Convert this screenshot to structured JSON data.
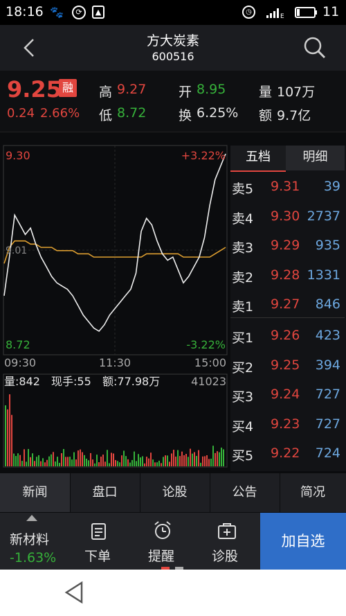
{
  "status": {
    "time": "18:16",
    "battery": "11"
  },
  "header": {
    "name": "方大炭素",
    "code": "600516"
  },
  "quote": {
    "price": "9.25",
    "badge": "融",
    "change": "0.24",
    "change_pct": "2.66%",
    "high_label": "高",
    "high": "9.27",
    "low_label": "低",
    "low": "8.72",
    "open_label": "开",
    "open": "8.95",
    "turnover_label": "换",
    "turnover": "6.25%",
    "volume_label": "量",
    "volume": "107万",
    "amount_label": "额",
    "amount": "9.7亿"
  },
  "chart": {
    "price_high": "9.30",
    "price_low": "8.72",
    "price_mid": "9.01",
    "pct_high": "+3.22%",
    "pct_low": "-3.22%",
    "time_start": "09:30",
    "time_mid": "11:30",
    "time_end": "15:00",
    "vol_label": "量:842",
    "hand_label": "现手:55",
    "amt_label": "额:77.98万",
    "vol_max": "41023",
    "colors": {
      "price_line": "#f0f0f0",
      "avg_line": "#e0a030",
      "up": "#e2463f",
      "down": "#36b23a"
    }
  },
  "chart_data": {
    "type": "line",
    "xlabel": "",
    "ylabel": "",
    "x_ticks": [
      "09:30",
      "11:30",
      "15:00"
    ],
    "ylim": [
      8.72,
      9.3
    ],
    "series": [
      {
        "values": [
          8.86,
          8.98,
          9.11,
          9.08,
          9.05,
          9.07,
          9.02,
          8.98,
          8.95,
          8.92,
          8.9,
          8.89,
          8.88,
          8.86,
          8.83,
          8.8,
          8.78,
          8.76,
          8.75,
          8.77,
          8.8,
          8.82,
          8.84,
          8.86,
          8.88,
          8.93,
          9.06,
          9.1,
          9.08,
          9.03,
          8.99,
          8.97,
          8.98,
          8.94,
          8.9,
          8.92,
          8.95,
          8.98,
          9.04,
          9.14,
          9.22,
          9.26,
          9.3
        ]
      },
      {
        "values": [
          8.96,
          9.01,
          9.03,
          9.03,
          9.03,
          9.02,
          9.02,
          9.01,
          9.01,
          9.01,
          9.0,
          9.0,
          9.0,
          9.0,
          8.99,
          8.99,
          8.99,
          8.98,
          8.98,
          8.98,
          8.98,
          8.98,
          8.98,
          8.98,
          8.98,
          8.98,
          8.98,
          8.99,
          8.99,
          8.99,
          8.99,
          8.99,
          8.99,
          8.99,
          8.98,
          8.98,
          8.98,
          8.98,
          8.98,
          8.98,
          8.99,
          9.0,
          9.01
        ]
      }
    ]
  },
  "book": {
    "tab_five": "五档",
    "tab_detail": "明细",
    "rows": [
      {
        "label": "卖5",
        "price": "9.31",
        "vol": "39"
      },
      {
        "label": "卖4",
        "price": "9.30",
        "vol": "2737"
      },
      {
        "label": "卖3",
        "price": "9.29",
        "vol": "935"
      },
      {
        "label": "卖2",
        "price": "9.28",
        "vol": "1331"
      },
      {
        "label": "卖1",
        "price": "9.27",
        "vol": "846"
      },
      {
        "label": "买1",
        "price": "9.26",
        "vol": "423"
      },
      {
        "label": "买2",
        "price": "9.25",
        "vol": "394"
      },
      {
        "label": "买3",
        "price": "9.24",
        "vol": "727"
      },
      {
        "label": "买4",
        "price": "9.23",
        "vol": "727"
      },
      {
        "label": "买5",
        "price": "9.22",
        "vol": "724"
      }
    ]
  },
  "tabs": [
    "新闻",
    "盘口",
    "论股",
    "公告",
    "简况"
  ],
  "bottom": {
    "sector_name": "新材料",
    "sector_pct": "-1.63%",
    "order_label": "下单",
    "alert_label": "提醒",
    "diagnose_label": "诊股",
    "add_label": "加自选"
  }
}
